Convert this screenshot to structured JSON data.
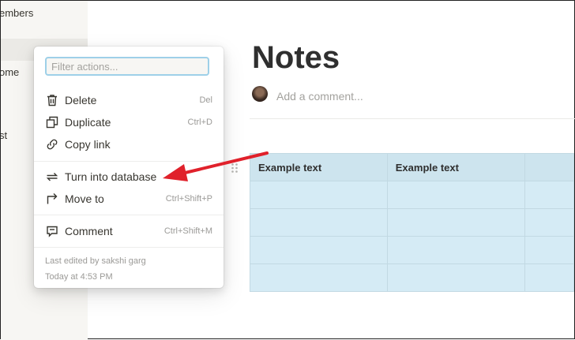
{
  "sidebar": {
    "items": [
      {
        "label": "embers"
      },
      {
        "label": "ome"
      },
      {
        "label": "st"
      }
    ]
  },
  "page": {
    "title": "Notes",
    "add_comment": "Add a comment..."
  },
  "table": {
    "headers": [
      "Example text",
      "Example text",
      ""
    ],
    "rows": [
      [
        "",
        "",
        ""
      ],
      [
        "",
        "",
        ""
      ],
      [
        "",
        "",
        ""
      ],
      [
        "",
        "",
        ""
      ]
    ]
  },
  "menu": {
    "filter_placeholder": "Filter actions...",
    "items": [
      {
        "label": "Delete",
        "shortcut": "Del",
        "icon": "trash-icon"
      },
      {
        "label": "Duplicate",
        "shortcut": "Ctrl+D",
        "icon": "duplicate-icon"
      },
      {
        "label": "Copy link",
        "shortcut": "",
        "icon": "link-icon"
      },
      {
        "label": "Turn into database",
        "shortcut": "",
        "icon": "turn-into-icon"
      },
      {
        "label": "Move to",
        "shortcut": "Ctrl+Shift+P",
        "icon": "move-to-icon"
      },
      {
        "label": "Comment",
        "shortcut": "Ctrl+Shift+M",
        "icon": "comment-icon"
      }
    ],
    "last_edited": "Last edited by sakshi garg",
    "edited_time": "Today at 4:53 PM"
  },
  "colors": {
    "accent": "#e0212b",
    "table_bg": "#d5ebf5",
    "focus_border": "#9ed0e8"
  }
}
